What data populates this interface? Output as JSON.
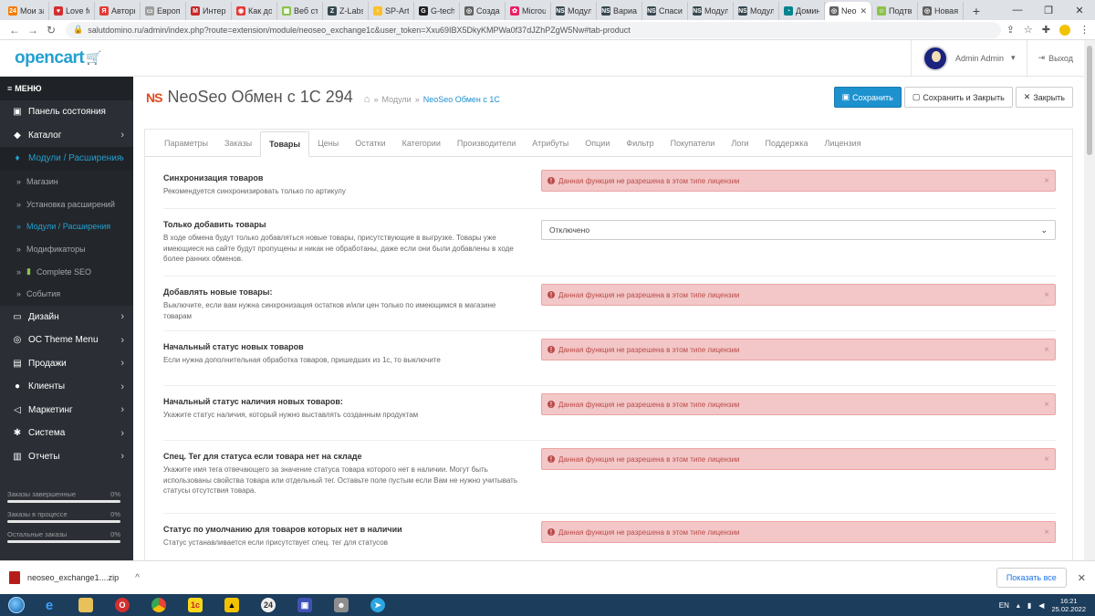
{
  "browser": {
    "tabs": [
      {
        "label": "Мои за",
        "color": "#f57c00",
        "glyph": "24"
      },
      {
        "label": "Love fo",
        "color": "#d32f2f",
        "glyph": "♥"
      },
      {
        "label": "Автори",
        "color": "#e53935",
        "glyph": "Я"
      },
      {
        "label": "Европа",
        "color": "#9e9e9e",
        "glyph": "▭"
      },
      {
        "label": "Интерн",
        "color": "#c62828",
        "glyph": "M"
      },
      {
        "label": "Как до",
        "color": "#e53935",
        "glyph": "◉"
      },
      {
        "label": "Веб ст",
        "color": "#8bc34a",
        "glyph": "▦"
      },
      {
        "label": "Z-Labs",
        "color": "#37474f",
        "glyph": "Z"
      },
      {
        "label": "SP-Arti",
        "color": "#fbc02d",
        "glyph": "♀"
      },
      {
        "label": "G-tech",
        "color": "#212121",
        "glyph": "G"
      },
      {
        "label": "Создан",
        "color": "#616161",
        "glyph": "◎"
      },
      {
        "label": "Microu",
        "color": "#e91e63",
        "glyph": "✿"
      },
      {
        "label": "Модул",
        "color": "#37474f",
        "glyph": "NS"
      },
      {
        "label": "Вариан",
        "color": "#37474f",
        "glyph": "NS"
      },
      {
        "label": "Спасиб",
        "color": "#37474f",
        "glyph": "NS"
      },
      {
        "label": "Модул",
        "color": "#37474f",
        "glyph": "NS"
      },
      {
        "label": "Модул",
        "color": "#37474f",
        "glyph": "NS"
      },
      {
        "label": "Домин",
        "color": "#00838f",
        "glyph": "◔"
      },
      {
        "label": "Neo",
        "color": "#616161",
        "glyph": "◎",
        "active": true
      },
      {
        "label": "Подтв",
        "color": "#8bc34a",
        "glyph": "☺"
      },
      {
        "label": "Новая",
        "color": "#616161",
        "glyph": "◎"
      }
    ],
    "url": "salutdomino.ru/admin/index.php?route=extension/module/neoseo_exchange1c&user_token=Xxu69IBX5DkyKMPWa0f37dJZhPZgW5Nw#tab-product"
  },
  "header": {
    "logo": "opencart",
    "user_name": "Admin Admin",
    "logout_label": "Выход"
  },
  "sidebar": {
    "menu_label": "МЕНЮ",
    "items": [
      {
        "label": "Панель состояния",
        "icon": "▣"
      },
      {
        "label": "Каталог",
        "icon": "◆",
        "chevron": true
      },
      {
        "label": "Модули / Расширения",
        "icon": "♦",
        "chevron": true,
        "active": true
      }
    ],
    "subitems": [
      {
        "label": "Магазин"
      },
      {
        "label": "Установка расширений"
      },
      {
        "label": "Модули / Расширения",
        "active": true
      },
      {
        "label": "Модификаторы"
      },
      {
        "label": "Complete SEO"
      },
      {
        "label": "События"
      }
    ],
    "items2": [
      {
        "label": "Дизайн",
        "icon": "▭",
        "chevron": true
      },
      {
        "label": "OC Theme Menu",
        "icon": "◎",
        "chevron": true
      },
      {
        "label": "Продажи",
        "icon": "▤",
        "chevron": true
      },
      {
        "label": "Клиенты",
        "icon": "●",
        "chevron": true
      },
      {
        "label": "Маркетинг",
        "icon": "◁",
        "chevron": true
      },
      {
        "label": "Система",
        "icon": "✱",
        "chevron": true
      },
      {
        "label": "Отчеты",
        "icon": "▥",
        "chevron": true
      }
    ],
    "stats": [
      {
        "label": "Заказы завершенные",
        "value": "0%"
      },
      {
        "label": "Заказы в процессе",
        "value": "0%"
      },
      {
        "label": "Остальные заказы",
        "value": "0%"
      }
    ]
  },
  "page": {
    "brand": "NS",
    "title": "NeoSeo Обмен с 1С 294",
    "breadcrumb": [
      "Модули",
      "NeoSeo Обмен с 1С"
    ],
    "save_label": "Сохранить",
    "save_close_label": "Сохранить и Закрыть",
    "close_label": "Закрыть"
  },
  "tabs": [
    "Параметры",
    "Заказы",
    "Товары",
    "Цены",
    "Остатки",
    "Категории",
    "Производители",
    "Атрибуты",
    "Опции",
    "Фильтр",
    "Покупатели",
    "Логи",
    "Поддержка",
    "Лицензия"
  ],
  "active_tab": "Товары",
  "alert_text": "Данная функция не разрешена в этом типе лицензии",
  "settings": [
    {
      "title": "Синхронизация товаров",
      "desc": "Рекомендуется синхронизировать только по артикулу"
    },
    {
      "title": "Только добавить товары",
      "desc": "В ходе обмена будут только добавляться новые товары, присутствующие в выгрузке. Товары уже имеющиеся на сайте будут пропущены и никак не обработаны, даже если они были добавлены в ходе более ранних обменов.",
      "select": "Отключено"
    },
    {
      "title": "Добавлять новые товары:",
      "desc": "Выключите, если вам нужна синхронизация остатков и/или цен только по имеющимся в магазине товарам"
    },
    {
      "title": "Начальный статус новых товаров",
      "desc": "Если нужна дополнительная обработка товаров, пришедших из 1с, то выключите"
    },
    {
      "title": "Начальный статус наличия новых товаров:",
      "desc": "Укажите статус наличия, который нужно выставлять созданным продуктам"
    },
    {
      "title": "Спец. Тег для статуса если товара нет на складе",
      "desc": "Укажите имя тега отвечающего за значение статуса товара которого нет в наличии. Могут быть использованы свойства товара или отдельный тег. Оставьте поле пустым если Вам не нужно учитывать статусы отсутствия товара."
    },
    {
      "title": "Статус по умолчанию для товаров которых нет в наличии",
      "desc": "Статус устанавливается если присутствует спец. тег для статусов"
    }
  ],
  "download": {
    "file": "neoseo_exchange1....zip",
    "show_all": "Показать все"
  },
  "taskbar": {
    "lang": "EN",
    "time": "16:21",
    "date": "25.02.2022"
  }
}
